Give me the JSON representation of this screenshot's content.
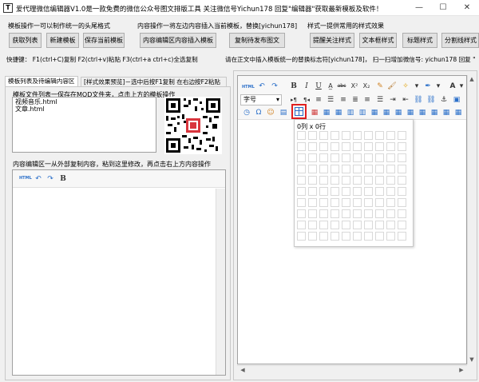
{
  "window": {
    "title": "爱代理微信编辑器V1.0是一款免费的微信公众号图文排版工具 关注微信号Yichun178 回复\"编辑器\"获取最新模板及软件！",
    "icon_letter": "T",
    "minimize": "—",
    "maximize": "☐",
    "close": "✕"
  },
  "groups": {
    "template_ops": "模板操作一可以制作统一的头尾格式",
    "content_ops": "内容操作一将左边内容插入当前模板，替换[yichun178]",
    "style_ops": "样式一提供常用的样式效果"
  },
  "buttons": {
    "get_list": "获取列表",
    "new_template": "新建模板",
    "save_template": "保存当前模板",
    "insert_content": "内容编辑区内容插入模板",
    "copy_publish": "复制待发布图文",
    "follow_style": "提醒关注样式",
    "textbox_style": "文本框样式",
    "heading_style": "标题样式",
    "divider_style": "分割线样式"
  },
  "hints": {
    "shortcuts": "快捷键：  F1(ctrl+C)复制    F2(ctrl+v)粘贴  F3(ctrl+a ctrl+c)全选复制",
    "insert_hint": "请在正文中插入模板统一的替换标志符[yichun178]，  扫一扫增加微信号: yichun178 回复 \"",
    "content_area": "内容编辑区一从外部复制内容，粘到这里修改，再点击右上方内容操作"
  },
  "tabs": {
    "list_tab": "模板列表及待编辑内容区",
    "preview_tab": "[样式效果预览]－选中后按F1复制 在右边按F2粘贴"
  },
  "file_list": {
    "header": "模板文件列表一保存在MOD文件夹，点击上方的模板操作",
    "items": [
      "视频音乐.html",
      "文章.html"
    ]
  },
  "mini_toolbar": {
    "html_label": "HTML",
    "bold_label": "B"
  },
  "right_toolbar": {
    "html_label": "HTML",
    "bold": "B",
    "italic": "I",
    "underline": "U",
    "font_size": "字号",
    "font_color": "A",
    "dropdown_arrow": "▾"
  },
  "table_picker": {
    "label": "0列 x 0行",
    "columns": 10,
    "rows": 10,
    "columns_selected": 0,
    "rows_selected": 0
  },
  "colors": {
    "highlight": "#e02020",
    "qr_red": "#d9363e",
    "accent_blue": "#2a6fc9"
  }
}
